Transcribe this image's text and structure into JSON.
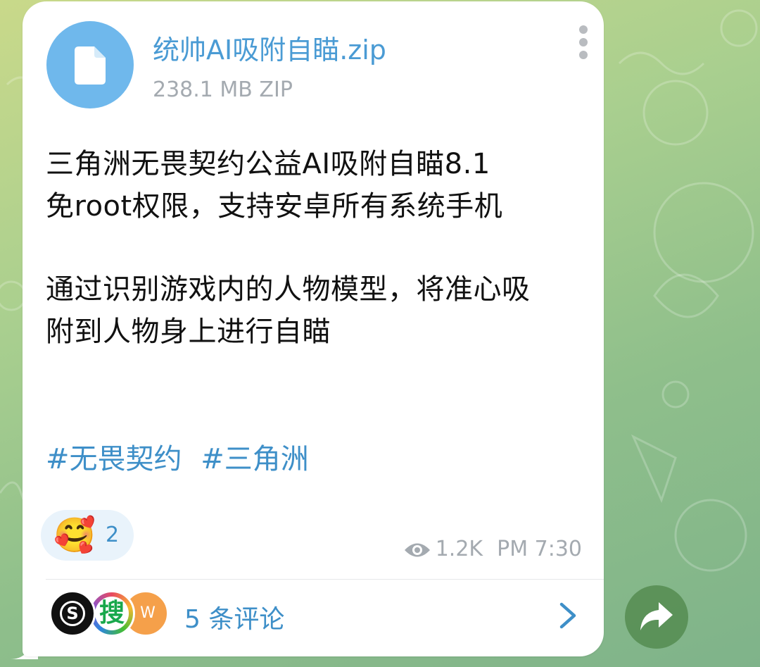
{
  "message": {
    "file": {
      "name": "统帅AI吸附自瞄.zip",
      "meta": "238.1 MB ZIP",
      "icon": "file-icon"
    },
    "text_lines": [
      "三角洲无畏契约公益AI吸附自瞄8.1",
      "免root权限，支持安卓所有系统手机",
      "通过识别游戏内的人物模型，将准心吸",
      "附到人物身上进行自瞄"
    ],
    "hashtags": [
      "#无畏契约",
      "#三角洲"
    ],
    "reaction": {
      "emoji": "🥰",
      "count": "2"
    },
    "views": "1.2K",
    "time": "PM 7:30",
    "comments_label": "5 条评论",
    "avatars": [
      "S",
      "搜",
      "W"
    ]
  },
  "colors": {
    "accent": "#3e8fc8",
    "file_icon_bg": "#6fb8ec",
    "meta_gray": "#a4aab0",
    "share_bg": "#558c50"
  }
}
